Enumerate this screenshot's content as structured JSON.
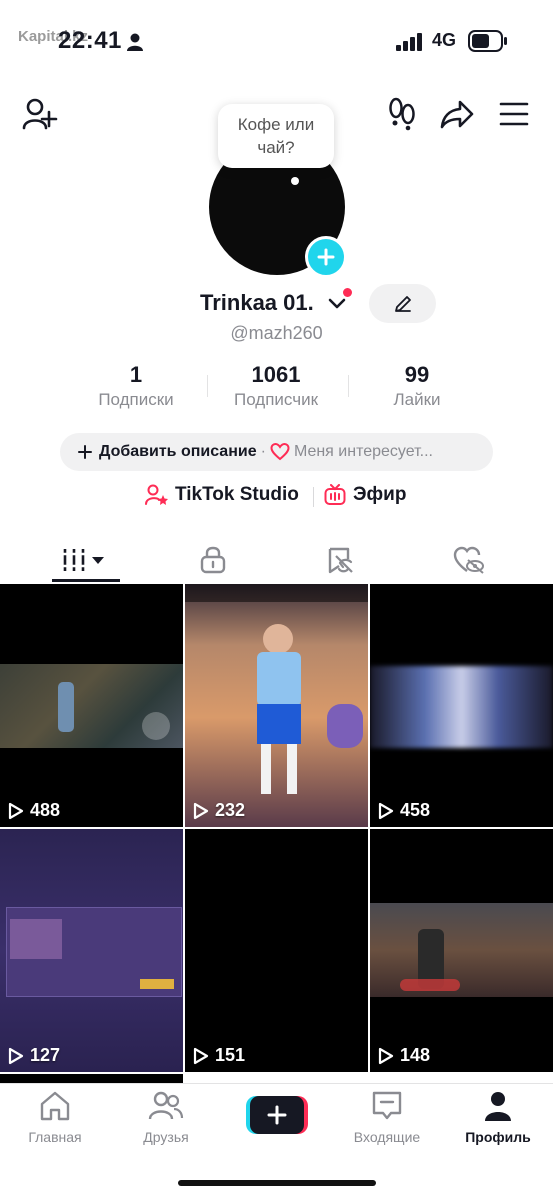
{
  "status_bar": {
    "time": "22:41",
    "network": "4G",
    "watermark": "Kapital.kz"
  },
  "profile": {
    "note_bubble": "Кофе или чай?",
    "name": "Trinkaa 01.",
    "handle": "@mazh260",
    "stats": [
      {
        "value": "1",
        "label": "Подписки"
      },
      {
        "value": "1061",
        "label": "Подписчик"
      },
      {
        "value": "99",
        "label": "Лайки"
      }
    ],
    "bio_add": "Добавить описание",
    "bio_separator": "·",
    "bio_interests": "Меня интересует...",
    "studio_label": "TikTok Studio",
    "live_label": "Эфир"
  },
  "tabs": [
    {
      "name": "videos",
      "icon": "grid-icon",
      "active": true
    },
    {
      "name": "private",
      "icon": "lock-icon",
      "active": false
    },
    {
      "name": "reposts",
      "icon": "repost-icon",
      "active": false
    },
    {
      "name": "liked",
      "icon": "heart-hidden-icon",
      "active": false
    }
  ],
  "videos": [
    {
      "views": "488"
    },
    {
      "views": "232"
    },
    {
      "views": "458"
    },
    {
      "views": "127"
    },
    {
      "views": "151"
    },
    {
      "views": "148"
    }
  ],
  "bottom_nav": [
    {
      "label": "Главная",
      "icon": "home-icon"
    },
    {
      "label": "Друзья",
      "icon": "friends-icon"
    },
    {
      "label": "",
      "icon": "create-icon"
    },
    {
      "label": "Входящие",
      "icon": "inbox-icon"
    },
    {
      "label": "Профиль",
      "icon": "profile-icon"
    }
  ],
  "colors": {
    "accent": "#fe2c55",
    "cyan": "#20d5ec",
    "text": "#161823",
    "muted": "#8a8b91"
  }
}
